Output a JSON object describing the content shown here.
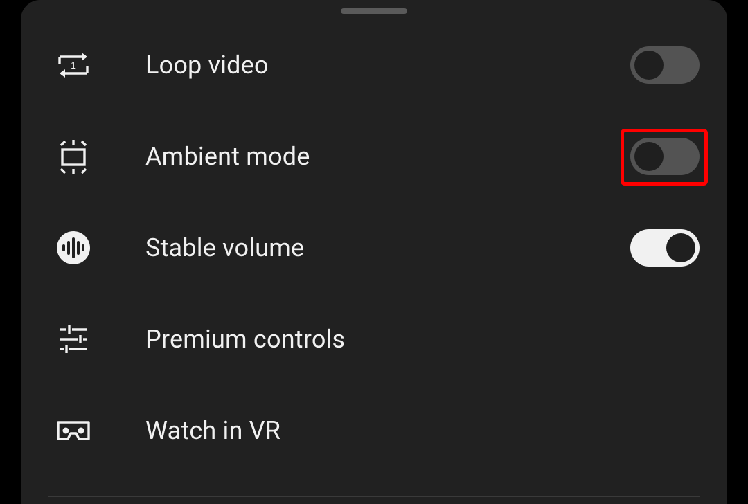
{
  "menu": {
    "items": [
      {
        "id": "loop-video",
        "label": "Loop video",
        "icon": "loop-icon",
        "toggle": "off"
      },
      {
        "id": "ambient-mode",
        "label": "Ambient mode",
        "icon": "ambient-icon",
        "toggle": "off",
        "highlight": true
      },
      {
        "id": "stable-volume",
        "label": "Stable volume",
        "icon": "stable-volume-icon",
        "toggle": "on"
      },
      {
        "id": "premium-controls",
        "label": "Premium controls",
        "icon": "sliders-icon",
        "toggle": null
      },
      {
        "id": "watch-in-vr",
        "label": "Watch in VR",
        "icon": "vr-icon",
        "toggle": null
      }
    ]
  },
  "colors": {
    "sheet_bg": "#212121",
    "text": "#f1f1f1",
    "toggle_off_track": "#535353",
    "toggle_on_track": "#f1f1f1",
    "toggle_knob": "#1f1f1f",
    "highlight": "#ff0000"
  }
}
